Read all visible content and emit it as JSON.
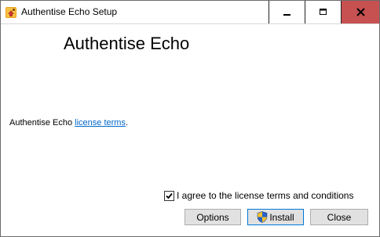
{
  "window": {
    "title": "Authentise Echo Setup",
    "close_color": "#c75050"
  },
  "main": {
    "heading": "Authentise Echo",
    "license_prefix": "Authentise Echo ",
    "license_link": "license terms",
    "license_suffix": "."
  },
  "agreement": {
    "label": "I agree to the license terms and conditions",
    "checked": true
  },
  "buttons": {
    "options": "Options",
    "install": "Install",
    "close": "Close"
  },
  "icons": {
    "app": "installer-icon",
    "install": "uac-shield-icon"
  },
  "colors": {
    "link": "#0066cc"
  }
}
